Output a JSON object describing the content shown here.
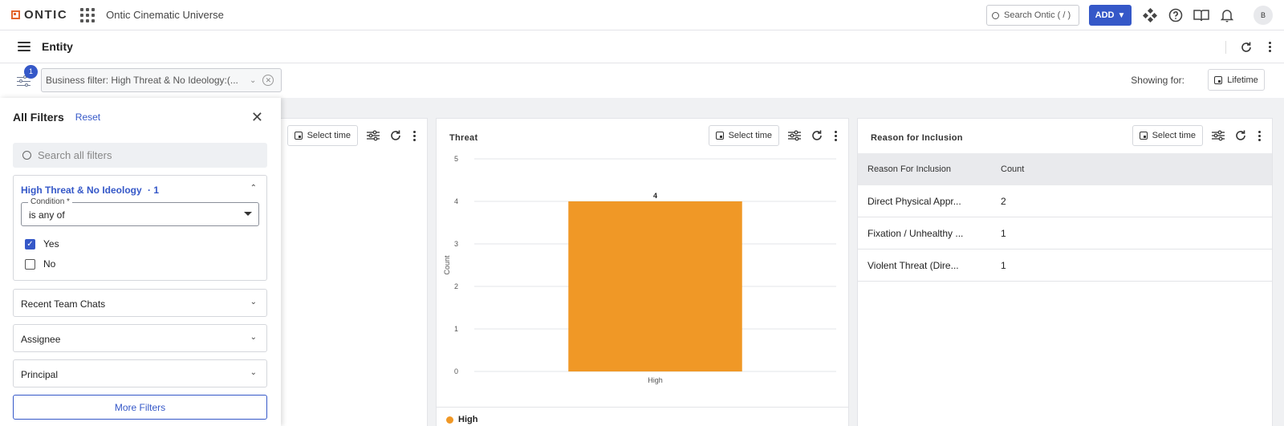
{
  "topbar": {
    "logo_text": "ONTIC",
    "app_name": "Ontic Cinematic Universe",
    "search_placeholder": "Search Ontic ( / )",
    "add_label": "ADD",
    "avatar_initial": "B"
  },
  "header": {
    "title": "Entity"
  },
  "filter_bar": {
    "badge_count": "1",
    "business_filter": "Business filter: High Threat & No Ideology:(...",
    "showing_for_label": "Showing for:",
    "lifetime_label": "Lifetime"
  },
  "filter_panel": {
    "title": "All Filters",
    "reset_label": "Reset",
    "search_placeholder": "Search all filters",
    "expanded_section": {
      "title": "High Threat & No Ideology",
      "count_suffix": "· 1",
      "condition_label": "Condition *",
      "condition_value": "is any of",
      "options": [
        {
          "label": "Yes",
          "checked": true
        },
        {
          "label": "No",
          "checked": false
        }
      ]
    },
    "sections": [
      {
        "label": "Recent Team Chats"
      },
      {
        "label": "Assignee"
      },
      {
        "label": "Principal"
      }
    ],
    "more_filters_label": "More Filters"
  },
  "cards": {
    "left": {
      "select_time_label": "Select time"
    },
    "threat": {
      "title": "Threat",
      "select_time_label": "Select time"
    },
    "reason": {
      "title": "Reason for Inclusion",
      "select_time_label": "Select time",
      "columns": [
        "Reason For Inclusion",
        "Count"
      ],
      "rows": [
        {
          "reason": "Direct Physical Appr...",
          "count": "2"
        },
        {
          "reason": "Fixation / Unhealthy ...",
          "count": "1"
        },
        {
          "reason": "Violent Threat (Dire...",
          "count": "1"
        }
      ]
    }
  },
  "chart_data": {
    "type": "bar",
    "categories": [
      "High"
    ],
    "values": [
      4
    ],
    "data_labels": [
      "4"
    ],
    "ylabel": "Count",
    "ylim": [
      0,
      5
    ],
    "yticks": [
      "0",
      "1",
      "2",
      "3",
      "4",
      "5"
    ],
    "grid": true,
    "legend": [
      {
        "name": "High",
        "color": "#f09826"
      }
    ],
    "bar_color": "#f09826"
  }
}
